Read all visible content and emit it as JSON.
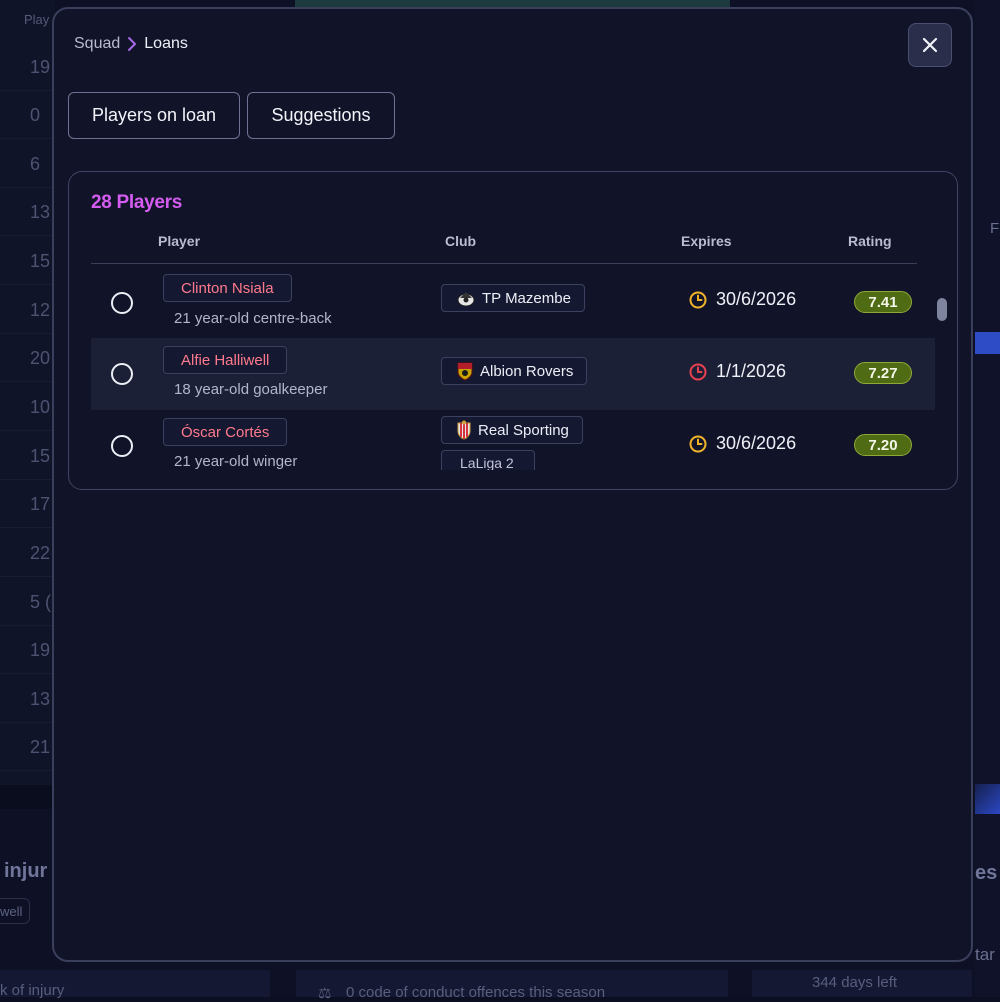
{
  "background": {
    "left_column_header": "Play",
    "left_column_values": [
      "19",
      "0",
      "6",
      "13",
      "15",
      "12",
      "20",
      "10",
      "15",
      "17",
      "22",
      "5 (",
      "19",
      "13",
      "21"
    ],
    "injuries_heading": "injur",
    "injured_player_chip": "well",
    "injury_caption": "k of injury",
    "conduct_text": "0 code of conduct offences this season",
    "days_left_text": "344 days left",
    "right_heading_fragment": "es",
    "right_text_fragment": "tar",
    "right_letter": "F"
  },
  "breadcrumb": {
    "parent": "Squad",
    "current": "Loans"
  },
  "tabs": [
    {
      "label": "Players on loan"
    },
    {
      "label": "Suggestions"
    }
  ],
  "table": {
    "count_label": "28 Players",
    "headers": {
      "player": "Player",
      "club": "Club",
      "expires": "Expires",
      "rating": "Rating"
    },
    "rows": [
      {
        "name": "Clinton Nsiala",
        "description": "21 year-old centre-back",
        "club": "TP Mazembe",
        "league": "",
        "expires": "30/6/2026",
        "expiry_color": "#f0b429",
        "rating": "7.41"
      },
      {
        "name": "Alfie Halliwell",
        "description": "18 year-old goalkeeper",
        "club": "Albion Rovers",
        "league": "",
        "expires": "1/1/2026",
        "expiry_color": "#e8414f",
        "rating": "7.27"
      },
      {
        "name": "Óscar Cortés",
        "description": "21 year-old winger",
        "club": "Real Sporting",
        "league": "LaLiga 2",
        "expires": "30/6/2026",
        "expiry_color": "#f0b429",
        "rating": "7.20"
      }
    ]
  },
  "colors": {
    "accent_count": "#d45cf0",
    "player_name": "#ff7a8c",
    "rating_fill": "#4f6b14"
  }
}
